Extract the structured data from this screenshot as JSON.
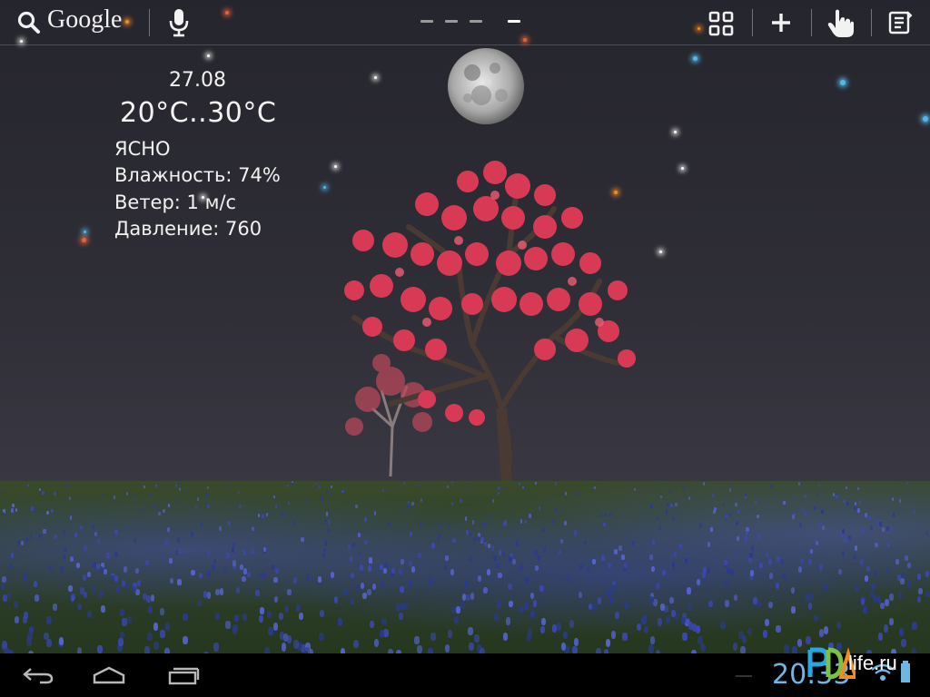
{
  "search": {
    "brand_label": "Google"
  },
  "home_pages": {
    "count": 4,
    "active_index": 3
  },
  "weather": {
    "date": "27.08",
    "temperature_range": "20°C..30°C",
    "condition": "ЯСНО",
    "humidity": "Влажность: 74%",
    "wind": "Ветер: 1 м/с",
    "pressure": "Давление: 760"
  },
  "status_bar": {
    "clock": "20:33"
  },
  "watermark": {
    "text": "life.ru"
  },
  "colors": {
    "clock": "#6fb6e3",
    "text": "#f2f2f2",
    "navbar": "#000000",
    "tree_blossom": "#d83a55",
    "bluebonnet": "#3b48b5"
  }
}
